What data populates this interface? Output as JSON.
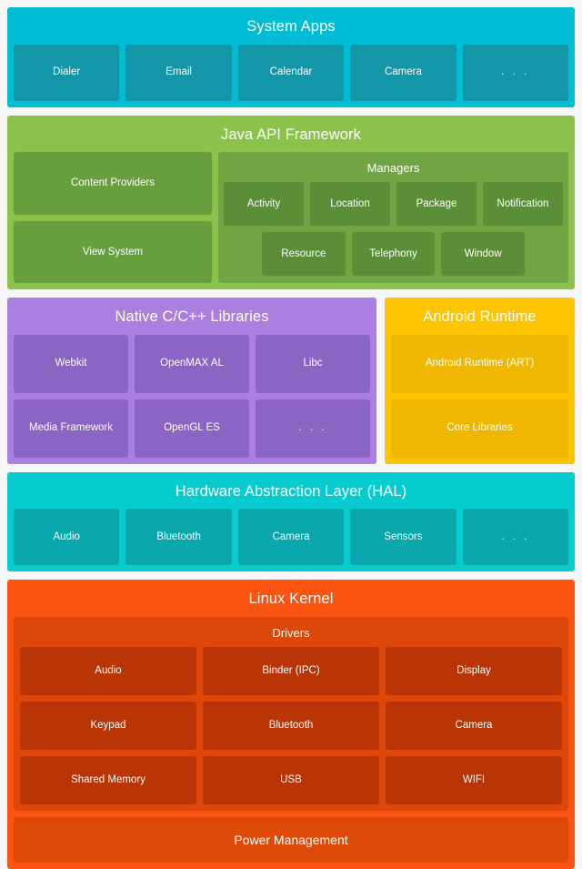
{
  "diagram": {
    "background_color": "#f7f7f7",
    "layers": [
      {
        "id": "system-apps",
        "title": "System Apps",
        "color": "#00bcd4",
        "tile_color": "#1296a8",
        "tiles": [
          "Dialer",
          "Email",
          "Calendar",
          "Camera",
          ". . ."
        ]
      },
      {
        "id": "java-api-framework",
        "title": "Java API Framework",
        "color": "#8bc34a",
        "tile_color": "#679f3e",
        "left_tiles": [
          "Content Providers",
          "View System"
        ],
        "managers": {
          "title": "Managers",
          "color": "#70a544",
          "tile_color": "#5a8f38",
          "row1": [
            "Activity",
            "Location",
            "Package",
            "Notification"
          ],
          "row2": [
            "Resource",
            "Telephony",
            "Window"
          ]
        }
      },
      {
        "id": "native-libraries",
        "title": "Native C/C++ Libraries",
        "color": "#ab7fe0",
        "tile_color": "#8a65c4",
        "row1": [
          "Webkit",
          "OpenMAX AL",
          "Libc"
        ],
        "row2": [
          "Media Framework",
          "OpenGL ES",
          ". . ."
        ]
      },
      {
        "id": "android-runtime",
        "title": "Android Runtime",
        "color": "#ffc400",
        "tile_color": "#efb700",
        "tiles": [
          "Android Runtime (ART)",
          "Core Libraries"
        ]
      },
      {
        "id": "hal",
        "title": "Hardware Abstraction Layer (HAL)",
        "color": "#06cbcf",
        "tile_color": "#0aa7ad",
        "tiles": [
          "Audio",
          "Bluetooth",
          "Camera",
          "Sensors",
          ". . ."
        ]
      },
      {
        "id": "linux-kernel",
        "title": "Linux Kernel",
        "color": "#fa5410",
        "drivers": {
          "title": "Drivers",
          "color": "#dd4709",
          "tile_color": "#b93505",
          "row1": [
            "Audio",
            "Binder (IPC)",
            "Display"
          ],
          "row2": [
            "Keypad",
            "Bluetooth",
            "Camera"
          ],
          "row3": [
            "Shared Memory",
            "USB",
            "WIFI"
          ]
        },
        "power_management": "Power Management"
      }
    ]
  }
}
